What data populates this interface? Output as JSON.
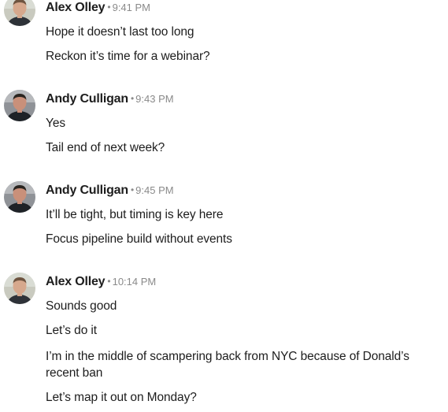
{
  "messages": [
    {
      "sender": "Alex Olley",
      "separator": "•",
      "time": "9:41 PM",
      "avatar": "person-avatar-light",
      "lines": [
        "Hope it doesn’t last too long",
        "Reckon it’s time for a webinar?"
      ]
    },
    {
      "sender": "Andy Culligan",
      "separator": "•",
      "time": "9:43 PM",
      "avatar": "person-avatar-dark",
      "lines": [
        "Yes",
        "Tail end of next week?"
      ]
    },
    {
      "sender": "Andy Culligan",
      "separator": "•",
      "time": "9:45 PM",
      "avatar": "person-avatar-dark",
      "lines": [
        "It’ll be tight, but timing is key here",
        "Focus pipeline build without events"
      ]
    },
    {
      "sender": "Alex Olley",
      "separator": "•",
      "time": "10:14 PM",
      "avatar": "person-avatar-light",
      "lines": [
        "Sounds good",
        "Let’s do it",
        "I’m in the middle of scampering back from NYC because of Donald’s recent ban",
        "Let’s map it out on Monday?"
      ]
    }
  ]
}
